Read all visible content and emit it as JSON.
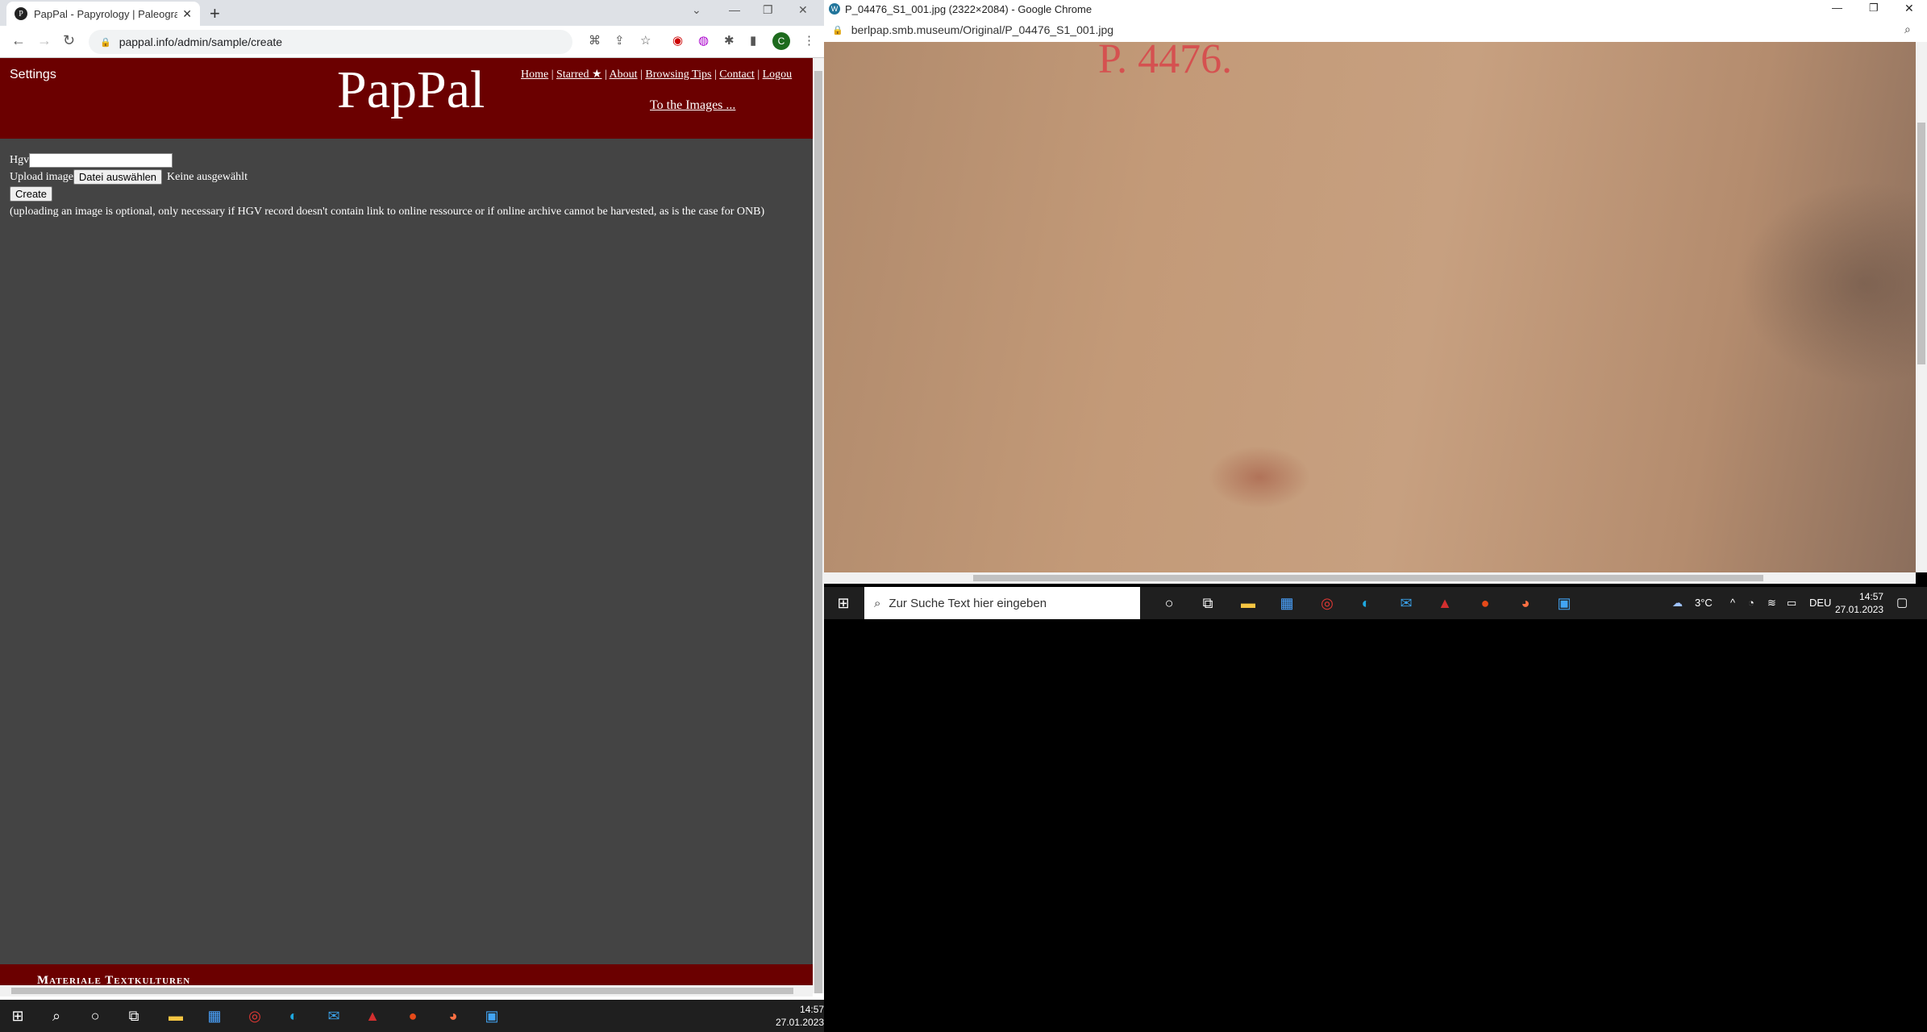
{
  "left": {
    "tab": {
      "title": "PapPal - Papyrology | Paleograph",
      "favicon": "P"
    },
    "address": "pappal.info/admin/sample/create",
    "avatar": "C",
    "header": {
      "settings": "Settings",
      "logo": "PapPal",
      "nav": [
        "Home",
        "Starred ★",
        "About",
        "Browsing Tips",
        "Contact",
        "Logou"
      ],
      "to_images": "To the Images ..."
    },
    "form": {
      "hgv_label": "Hgv",
      "upload_label": "Upload image",
      "file_button": "Datei auswählen",
      "file_status": "Keine ausgewählt",
      "create_button": "Create",
      "note": "(uploading an image is optional, only necessary if HGV record doesn't contain link to online ressource or if online archive cannot be harvested, as is the case for ONB)"
    },
    "footer": "Materiale Textkulturen",
    "clock": {
      "time": "14:57",
      "date": "27.01.2023"
    }
  },
  "right": {
    "title": "P_04476_S1_001.jpg (2322×2084) - Google Chrome",
    "address": "berlpap.smb.museum/Original/P_04476_S1_001.jpg",
    "image_red_text": "P. 4476.",
    "search_placeholder": "Zur Suche Text hier eingeben",
    "weather": "3°C",
    "lang": "DEU",
    "clock": {
      "time": "14:57",
      "date": "27.01.2023"
    }
  }
}
